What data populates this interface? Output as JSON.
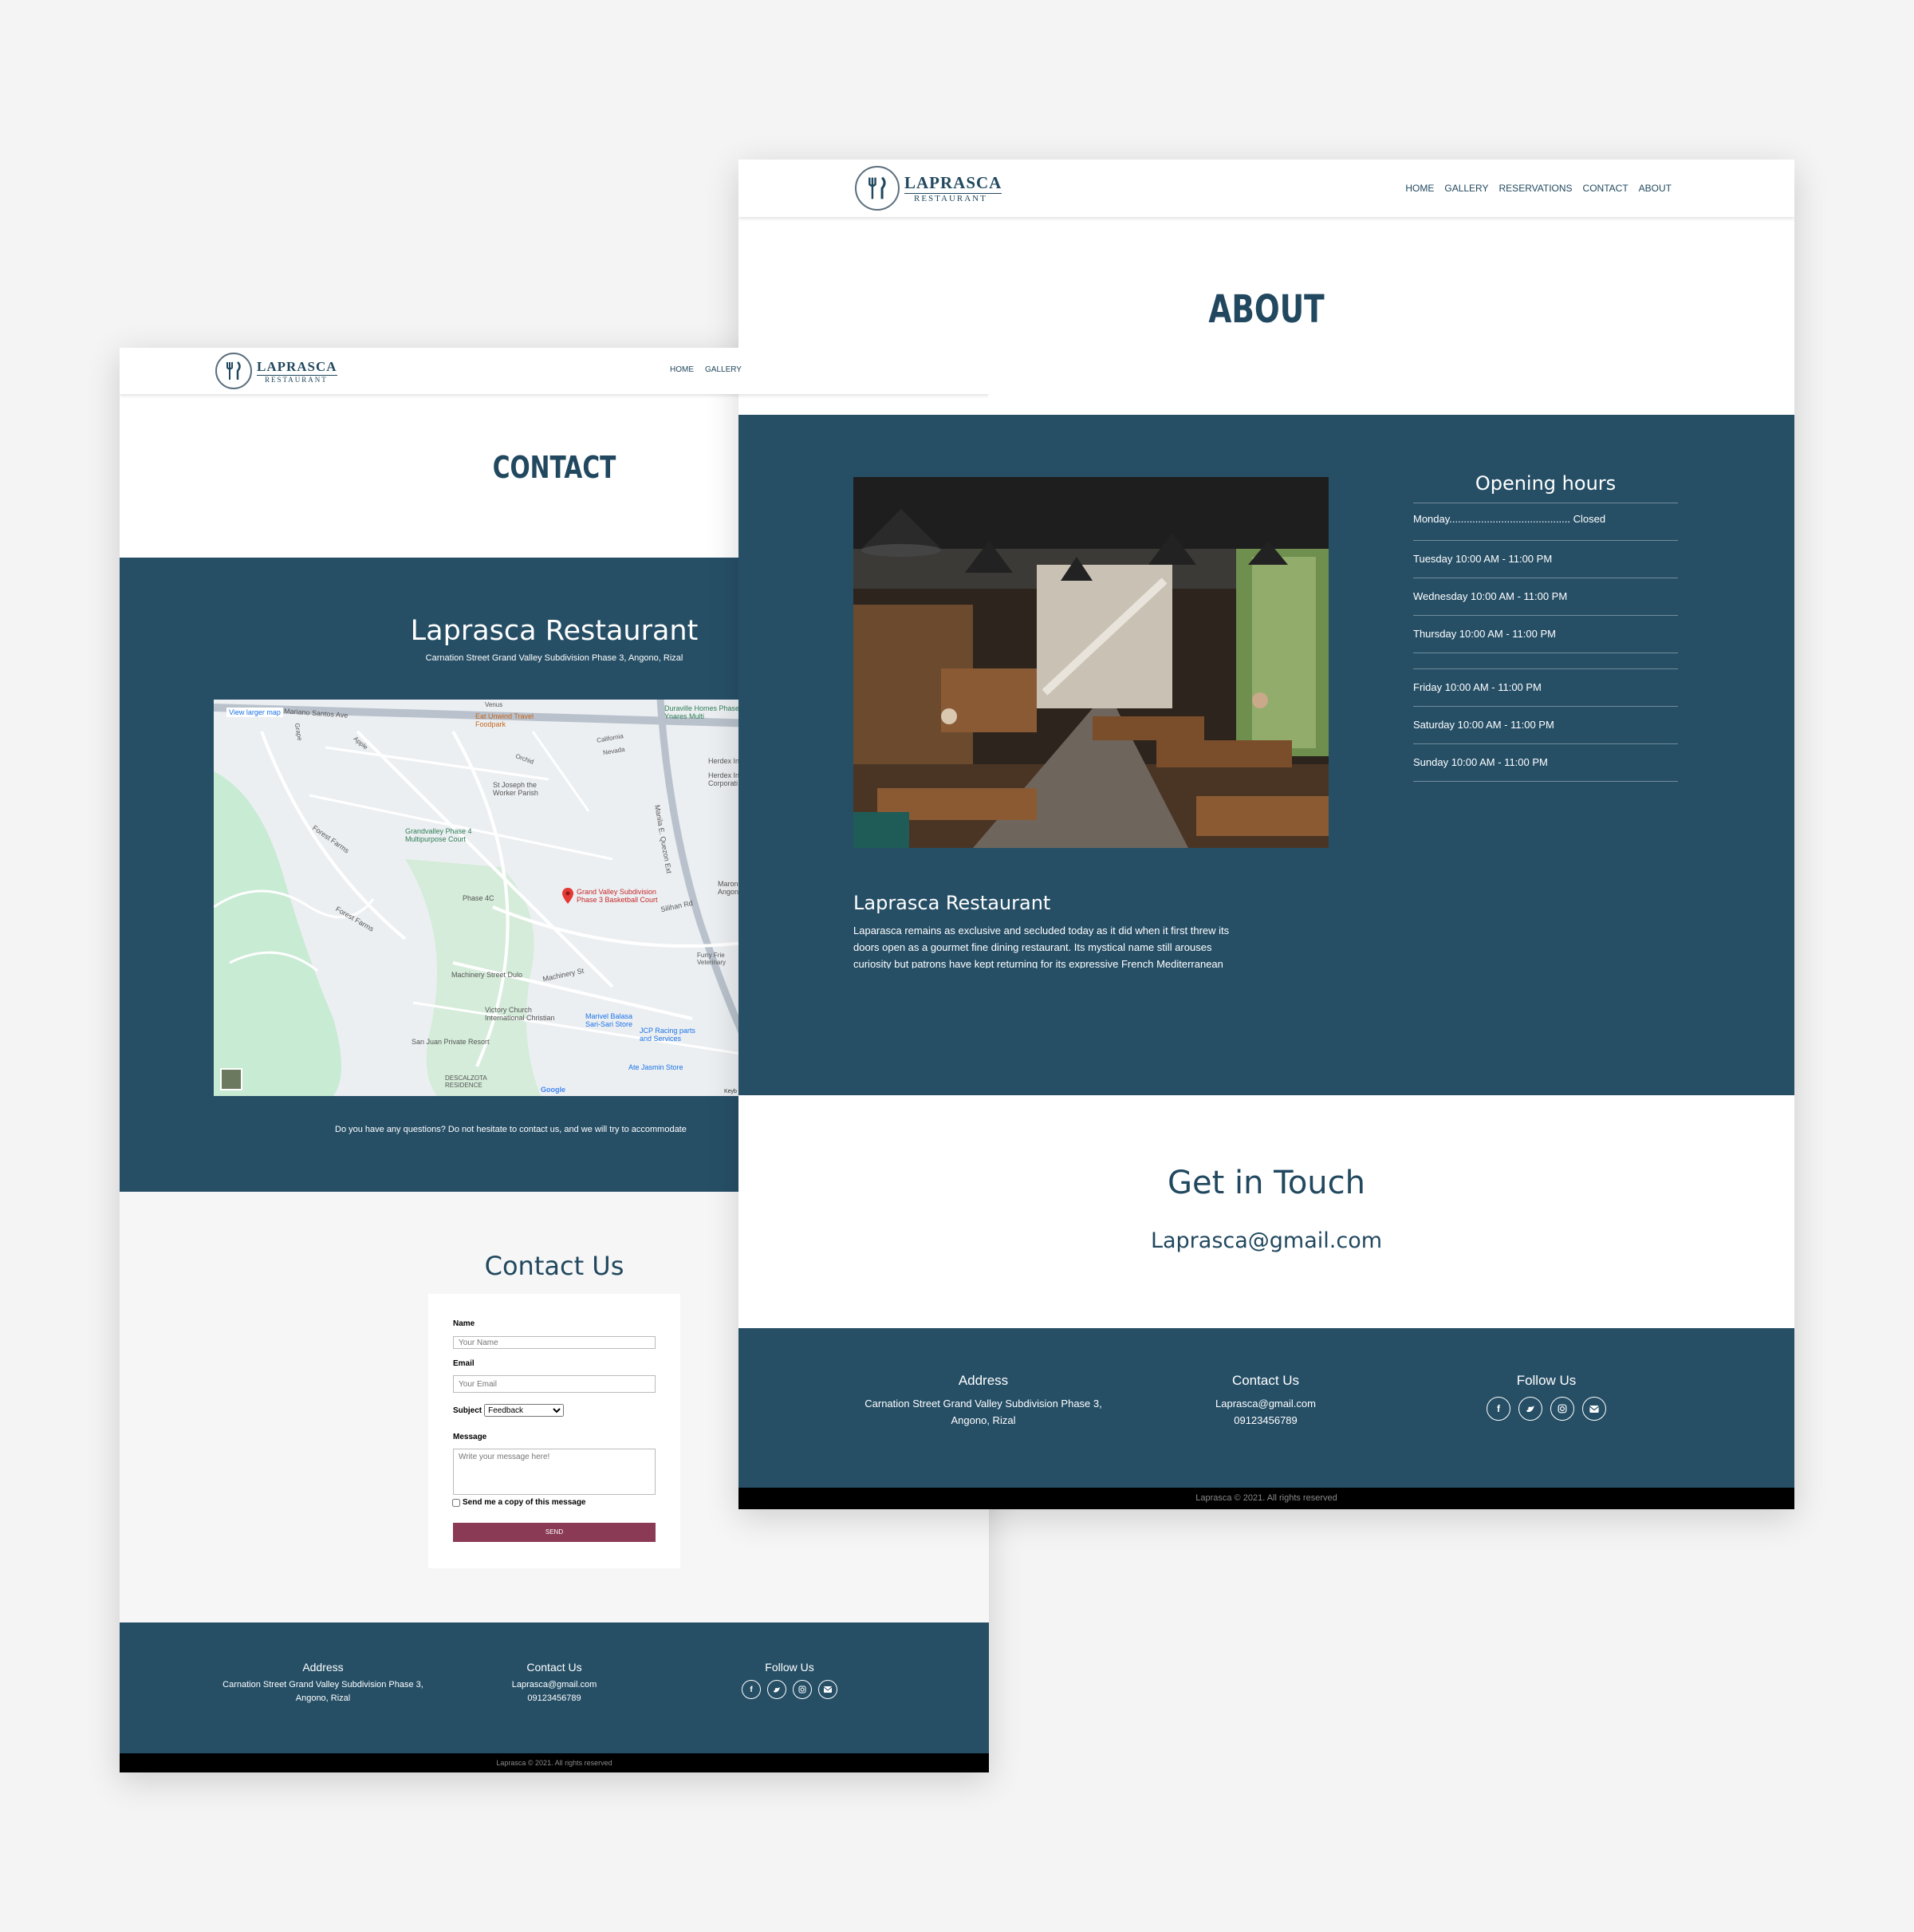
{
  "brand": {
    "name": "LAPRASCA",
    "sub": "RESTAURANT"
  },
  "contact_page": {
    "nav": [
      "HOME",
      "GALLERY"
    ],
    "title": "CONTACT",
    "restaurant_name": "Laprasca Restaurant",
    "address": "Carnation Street Grand Valley Subdivision Phase 3, Angono, Rizal",
    "map": {
      "view_larger": "View larger map",
      "labels": {
        "mariano_santos": "Mariano Santos Ave",
        "eat_unwind": "Eat Unwind Travel Foodpark",
        "duraville": "Duraville Homes Phase 2 Ynares Multi",
        "venus": "Venus",
        "california": "California",
        "nevada": "Nevada",
        "orchid": "Orchid",
        "apple": "Apple",
        "grape": "Grape",
        "st_joseph": "St Joseph the Worker Parish",
        "herdex": "Herdex In",
        "herdex2": "Herdex In Corporati",
        "grandvalley_court": "Grandvalley Phase 4 Multipurpose Court",
        "pin": "Grand Valley Subdivision Phase 3 Basketball Court",
        "phase4c": "Phase 4C",
        "marong": "Marong Barbe Angono",
        "forest_farms": "Forest Farms",
        "quezon": "Manila E. Quezon Ext",
        "silihan": "Silihan Rd",
        "machinery_dulo": "Machinery Street Dulo",
        "machinery_st": "Machinery St",
        "victory": "Victory Church International Christian",
        "marivel": "Marivel Balasa Sari-Sari Store",
        "jcp": "JCP Racing parts and Services",
        "san_juan": "San Juan Private Resort",
        "ate_jasmin": "Ate Jasmin Store",
        "descalzota": "DESCALZOTA RESIDENCE",
        "furry": "Furry Frie Veterinary",
        "google": "Google",
        "keyb": "Keyb"
      }
    },
    "question": "Do you have any questions? Do not hesitate to contact us, and we will try to accommodate",
    "form": {
      "heading": "Contact Us",
      "name_label": "Name",
      "name_placeholder": "Your Name",
      "email_label": "Email",
      "email_placeholder": "Your Email",
      "subject_label": "Subject",
      "subject_value": "Feedback",
      "message_label": "Message",
      "message_placeholder": "Write your message here!",
      "copy_label": "Send me a copy of this message",
      "send": "SEND"
    }
  },
  "about_page": {
    "nav": [
      "HOME",
      "GALLERY",
      "RESERVATIONS",
      "CONTACT",
      "ABOUT"
    ],
    "title": "ABOUT",
    "opening_hours": {
      "heading": "Opening hours",
      "rows": [
        "Monday.......................................... Closed",
        "Tuesday 10:00 AM - 11:00 PM",
        "Wednesday 10:00 AM - 11:00 PM",
        "Thursday 10:00 AM - 11:00 PM",
        "Friday 10:00 AM - 11:00 PM",
        "Saturday 10:00 AM - 11:00 PM",
        "Sunday 10:00 AM - 11:00 PM"
      ]
    },
    "restaurant_name": "Laprasca Restaurant",
    "description": "Laparasca remains as exclusive and secluded today as it did when it first threw its doors open as a gourmet fine dining restaurant. Its mystical name still arouses curiosity but patrons have kept returning for its expressive French Mediterranean cuisine made from scratch using only the best and freshest ingredients, including home-made bread and ice cream.",
    "get_in_touch": "Get in Touch",
    "email": "Laprasca@gmail.com"
  },
  "footer": {
    "address_heading": "Address",
    "address": "Carnation Street Grand Valley Subdivision Phase 3, Angono, Rizal",
    "contact_heading": "Contact Us",
    "contact_email": "Laprasca@gmail.com",
    "contact_phone": "09123456789",
    "follow_heading": "Follow Us",
    "social_icons": [
      "facebook-icon",
      "twitter-icon",
      "instagram-icon",
      "email-icon"
    ],
    "copyright": "Laprasca © 2021. All rights reserved"
  },
  "colors": {
    "primary": "#264f66",
    "send_button": "#8a3a55",
    "background": "#f4f4f4"
  }
}
